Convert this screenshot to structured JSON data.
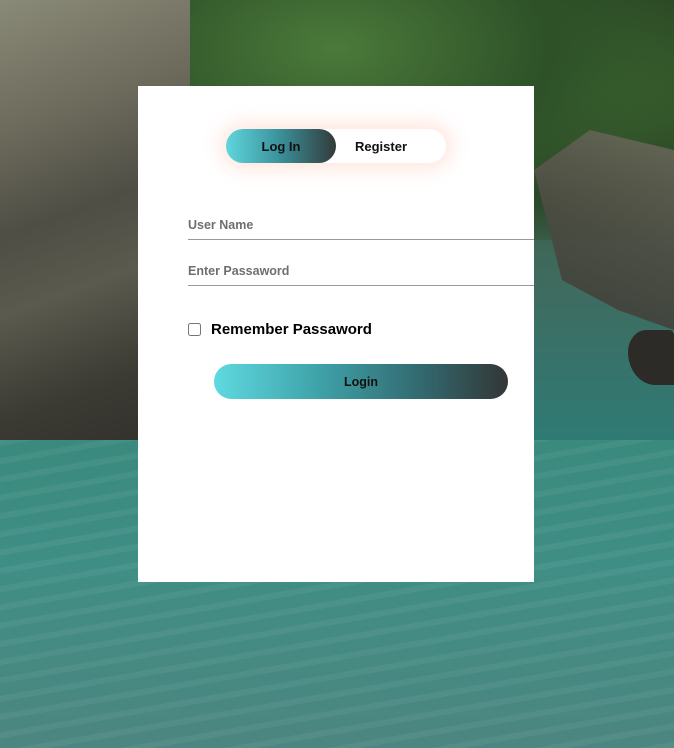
{
  "background": {
    "description_icon": "mountain-river-photo"
  },
  "tabs": {
    "login_label": "Log In",
    "register_label": "Register",
    "active": "login"
  },
  "form": {
    "username_placeholder": "User Name",
    "password_placeholder": "Enter Passaword",
    "remember_label": "Remember Passaword",
    "remember_checked": false,
    "submit_label": "Login"
  },
  "colors": {
    "accent_start": "#5fd6de",
    "accent_end": "#333a3a",
    "card": "#ffffff"
  }
}
